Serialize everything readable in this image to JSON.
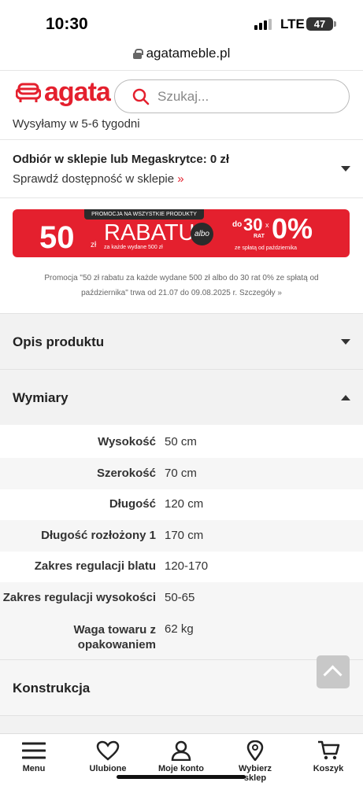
{
  "status_bar": {
    "time": "10:30",
    "network": "LTE",
    "battery": "47"
  },
  "browser": {
    "url": "agatameble.pl"
  },
  "header": {
    "logo_text": "agata",
    "search_placeholder": "Szukaj..."
  },
  "shipping_note": "Wysyłamy w 5-6 tygodni",
  "pickup": {
    "title": "Odbiór w sklepie lub Megaskrytce: 0 zł",
    "link": "Sprawdź dostępność w sklepie",
    "link_arrow": "»"
  },
  "promo_banner": {
    "top": "PROMOCJA NA WSZYSTKIE PRODUKTY",
    "amount": "50",
    "currency": "zł",
    "rabatu": "RABATU",
    "sub": "za każde wydane 500 zł",
    "albo": "albo",
    "do": "do",
    "rat_count": "30",
    "rat_label": "RAT",
    "x": "x",
    "zero_percent": "0%",
    "footer": "ze spłatą od października"
  },
  "promo_text": "Promocja \"50 zł rabatu za każde wydane 500 zł albo do 30 rat 0% ze spłatą od października\" trwa od 21.07 do 09.08.2025 r. Szczegóły »",
  "sections": {
    "opis": "Opis produktu",
    "wymiary": "Wymiary",
    "konstrukcja": "Konstrukcja"
  },
  "dimensions": [
    {
      "label": "Wysokość",
      "value": "50 cm"
    },
    {
      "label": "Szerokość",
      "value": "70 cm"
    },
    {
      "label": "Długość",
      "value": "120 cm"
    },
    {
      "label": "Długość rozłożony 1",
      "value": "170 cm"
    },
    {
      "label": "Zakres regulacji blatu",
      "value": "120-170"
    },
    {
      "label": "Zakres regulacji wysokości",
      "value": "50-65"
    },
    {
      "label": "Waga towaru z opakowaniem",
      "value": "62 kg"
    }
  ],
  "bottom_nav": [
    {
      "label": "Menu",
      "icon": "menu-icon"
    },
    {
      "label": "Ulubione",
      "icon": "heart-icon"
    },
    {
      "label": "Moje konto",
      "icon": "user-icon"
    },
    {
      "label": "Wybierz sklep",
      "icon": "location-pin-icon"
    },
    {
      "label": "Koszyk",
      "icon": "cart-icon"
    }
  ],
  "colors": {
    "brand_red": "#e4202e",
    "section_bg": "#f2f2f2"
  }
}
